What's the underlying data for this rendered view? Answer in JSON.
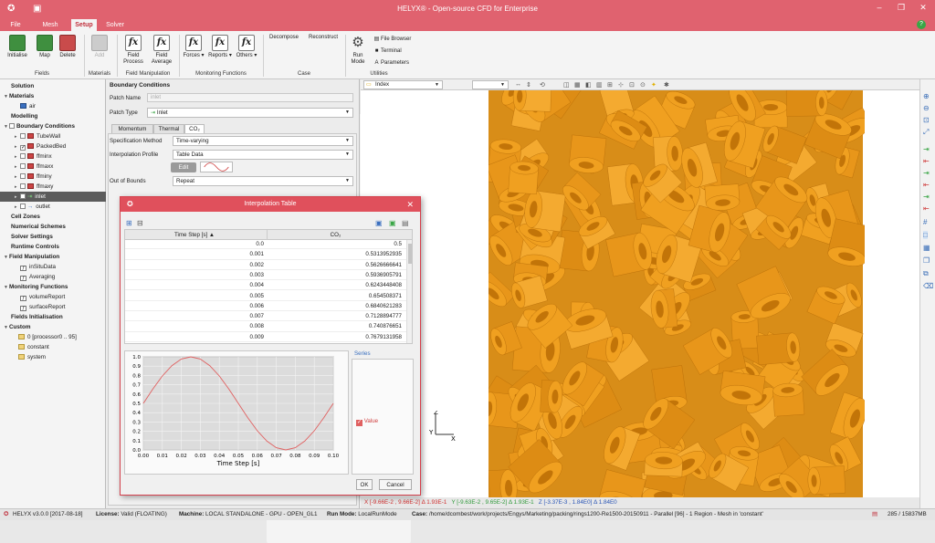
{
  "app": {
    "title": "HELYX® - Open-source CFD for Enterprise",
    "tabs": [
      "File",
      "Mesh",
      "Setup",
      "Solver"
    ],
    "active_tab": "Setup"
  },
  "ribbon": {
    "buttons": {
      "initialise": "Initialise",
      "map": "Map",
      "delete": "Delete",
      "add": "Add",
      "field_process": [
        "Field",
        "Process"
      ],
      "field_average": [
        "Field",
        "Average"
      ],
      "forces": "Forces",
      "reports": "Reports",
      "others": "Others",
      "decompose": "Decompose",
      "reconstruct": "Reconstruct",
      "run_mode": [
        "Run",
        "Mode"
      ],
      "file_browser": "File Browser",
      "terminal": "Terminal",
      "parameters": "Parameters"
    },
    "groups": {
      "fields": "Fields",
      "materials": "Materials",
      "field_manipulation": "Field Manipulation",
      "monitoring_functions": "Monitoring Functions",
      "case": "Case",
      "utilities": "Utilities"
    }
  },
  "tree": {
    "solution": "Solution",
    "materials": "Materials",
    "air": "air",
    "modelling": "Modelling",
    "boundary_conditions": "Boundary Conditions",
    "tubewall": "TubeWall",
    "packedbed": "PackedBed",
    "ffminx": "ffminx",
    "ffmaxx": "ffmaxx",
    "ffminy": "ffminy",
    "ffmaxy": "ffmaxy",
    "inlet": "inlet",
    "outlet": "outlet",
    "cell_zones": "Cell Zones",
    "numerical_schemes": "Numerical Schemes",
    "solver_settings": "Solver Settings",
    "runtime_controls": "Runtime Controls",
    "field_manipulation": "Field Manipulation",
    "insitudata": "inSituData",
    "averaging": "Averaging",
    "monitoring_functions": "Monitoring Functions",
    "volumereport": "volumeReport",
    "surfacereport": "surfaceReport",
    "fields_initialisation": "Fields Initialisation",
    "custom": "Custom",
    "processor": "0 [processor0 .. 95]",
    "constant": "constant",
    "system": "system"
  },
  "panel": {
    "title": "Boundary Conditions",
    "patch_name_label": "Patch Name",
    "patch_name_value": "inlet",
    "patch_type_label": "Patch Type",
    "patch_type_value": "Inlet",
    "subtabs": [
      "Momentum",
      "Thermal",
      "CO₂"
    ],
    "spec_method_label": "Specification Method",
    "spec_method_value": "Time-varying",
    "interp_profile_label": "Interpolation Profile",
    "interp_profile_value": "Table Data",
    "edit_label": "Edit",
    "out_of_bounds_label": "Out of Bounds",
    "out_of_bounds_value": "Repeat"
  },
  "dialog": {
    "title": "Interpolation Table",
    "col_time": "Time Step [s]",
    "col_co2": "CO₂",
    "rows": [
      [
        "0.0",
        "0.5"
      ],
      [
        "0.001",
        "0.5313952935"
      ],
      [
        "0.002",
        "0.5626666641"
      ],
      [
        "0.003",
        "0.5936905791"
      ],
      [
        "0.004",
        "0.6243448408"
      ],
      [
        "0.005",
        "0.654508371"
      ],
      [
        "0.006",
        "0.6840621283"
      ],
      [
        "0.007",
        "0.7128894777"
      ],
      [
        "0.008",
        "0.740876651"
      ],
      [
        "0.009",
        "0.7679131958"
      ]
    ],
    "series_label": "Series",
    "series_value": "Value",
    "ok": "OK",
    "cancel": "Cancel"
  },
  "chart_data": {
    "type": "line",
    "xlabel": "Time Step [s]",
    "ylabel": "",
    "xlim": [
      0.0,
      0.1
    ],
    "ylim": [
      0.0,
      1.0
    ],
    "x_ticks": [
      "0.00",
      "0.01",
      "0.02",
      "0.03",
      "0.04",
      "0.05",
      "0.06",
      "0.07",
      "0.08",
      "0.09",
      "0.10"
    ],
    "y_ticks": [
      "0.0",
      "0.1",
      "0.2",
      "0.3",
      "0.4",
      "0.5",
      "0.6",
      "0.7",
      "0.8",
      "0.9",
      "1.0"
    ],
    "grid": true,
    "series": [
      {
        "name": "Value",
        "color": "#e06060",
        "x": [
          0.0,
          0.005,
          0.01,
          0.015,
          0.02,
          0.025,
          0.03,
          0.035,
          0.04,
          0.045,
          0.05,
          0.055,
          0.06,
          0.065,
          0.07,
          0.075,
          0.08,
          0.085,
          0.09,
          0.095,
          0.1
        ],
        "y": [
          0.5,
          0.655,
          0.794,
          0.905,
          0.976,
          1.0,
          0.976,
          0.905,
          0.794,
          0.655,
          0.5,
          0.345,
          0.206,
          0.095,
          0.024,
          0.0,
          0.024,
          0.095,
          0.206,
          0.345,
          0.5
        ]
      }
    ]
  },
  "viewport": {
    "field_select": "Index"
  },
  "coords": {
    "x": "X [-9.66E-2 , 9.66E-2] Δ 1.93E-1",
    "y": "Y [-9.63E-2 , 9.65E-2] Δ 1.93E-1",
    "z": "Z [-3.37E-3 , 1.84E0] Δ 1.84E0"
  },
  "status": {
    "version": "HELYX  v3.0.0 [2017-08-18]",
    "license_label": "License:",
    "license_value": "Valid (FLOATING)",
    "machine_label": "Machine:",
    "machine_value": "LOCAL STANDALONE - GPU - OPEN_GL1",
    "runmode_label": "Run Mode:",
    "runmode_value": "LocalRunMode",
    "case_label": "Case:",
    "case_value": "/home/dcombest/work/projects/Engys/Marketing/packing/rings1200-Re1500-20150911 - Parallel [96] - 1 Region - Mesh in 'constant'",
    "memory": "285 / 15837MB"
  },
  "colors": {
    "accent": "#e0626f",
    "rings": "#f0a020",
    "series": "#e06060"
  }
}
